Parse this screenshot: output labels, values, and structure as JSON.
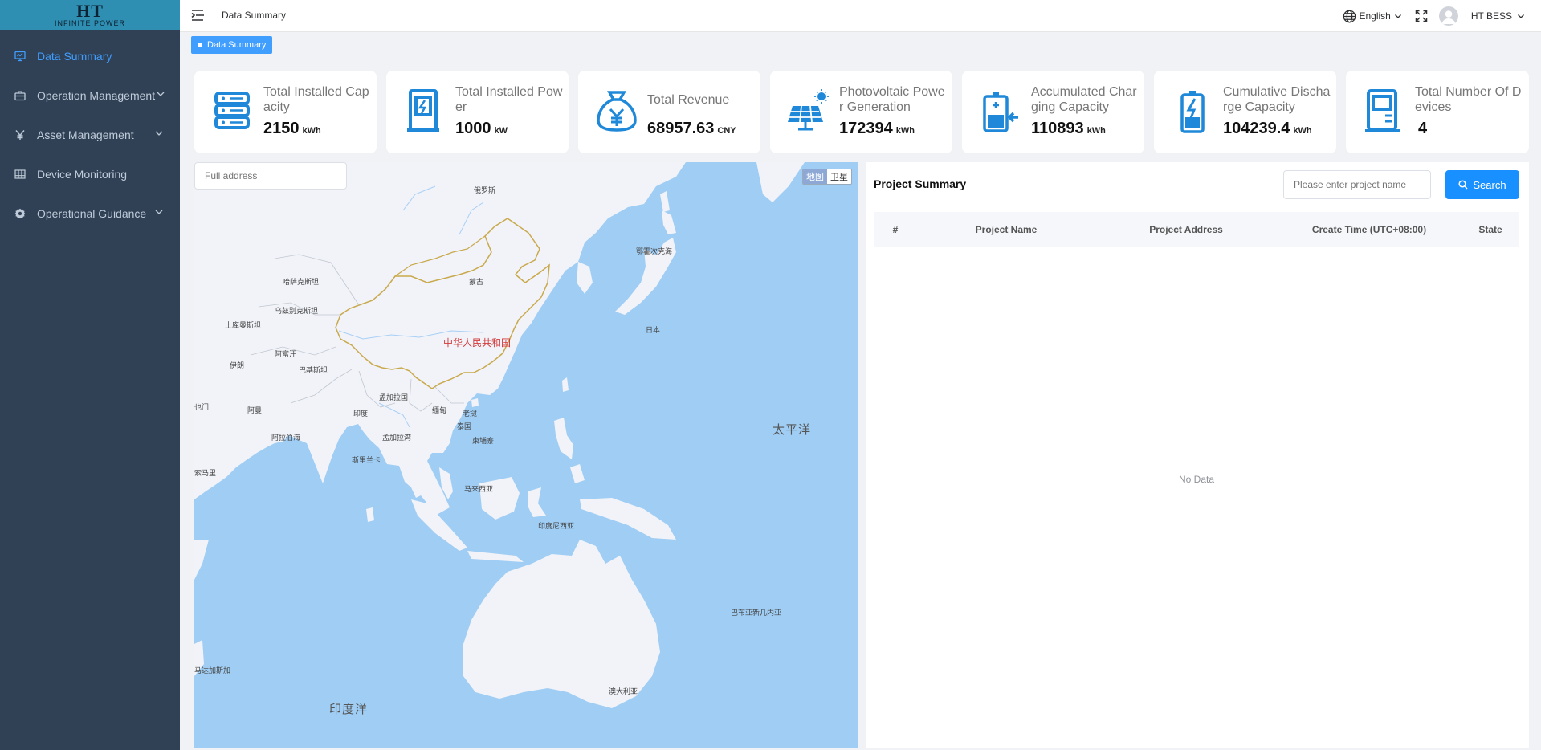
{
  "logo": {
    "mark": "HT",
    "sub": "INFINITE POWER"
  },
  "sidebar": {
    "items": [
      {
        "label": "Data Summary",
        "icon": "monitor-icon",
        "active": true
      },
      {
        "label": "Operation Management",
        "icon": "briefcase-icon",
        "has_children": true
      },
      {
        "label": "Asset Management",
        "icon": "yen-icon",
        "has_children": true
      },
      {
        "label": "Device Monitoring",
        "icon": "grid-icon"
      },
      {
        "label": "Operational Guidance",
        "icon": "gear-icon",
        "has_children": true
      }
    ]
  },
  "navbar": {
    "breadcrumb": "Data Summary",
    "language": "English",
    "user": "HT BESS"
  },
  "tags": {
    "active": "Data Summary"
  },
  "stats": [
    {
      "label": "Total Installed Capacity",
      "value": "2150",
      "unit": "kWh",
      "icon": "database-icon"
    },
    {
      "label": "Total Installed Power",
      "value": "1000",
      "unit": "kW",
      "icon": "charging-cabinet-icon"
    },
    {
      "label": "Total Revenue",
      "value": "68957.63",
      "unit": "CNY",
      "icon": "money-bag-icon"
    },
    {
      "label": "Photovoltaic Power Generation",
      "value": "172394",
      "unit": "kWh",
      "icon": "solar-panel-icon"
    },
    {
      "label": "Accumulated Charging Capacity",
      "value": "110893",
      "unit": "kWh",
      "icon": "battery-charge-icon"
    },
    {
      "label": "Cumulative Discharge Capacity",
      "value": "104239.4",
      "unit": "kWh",
      "icon": "battery-bolt-icon"
    },
    {
      "label": "Total Number Of Devices",
      "value": "4",
      "unit": "",
      "icon": "device-cabinet-icon"
    }
  ],
  "map": {
    "address_placeholder": "Full address",
    "type_map": "地图",
    "type_satellite": "卫星",
    "labels": {
      "russia": "俄罗斯",
      "kazakhstan": "哈萨克斯坦",
      "mongolia": "蒙古",
      "china": "中华人民共和国",
      "uzbekistan": "乌兹别克斯坦",
      "turkmenistan": "土库曼斯坦",
      "afghanistan": "阿富汗",
      "iran": "伊朗",
      "pakistan": "巴基斯坦",
      "oman": "阿曼",
      "india": "印度",
      "bangladesh": "孟加拉国",
      "myanmar": "缅甸",
      "thailand": "泰国",
      "laos": "老挝",
      "cambodia": "柬埔寨",
      "sri_lanka": "斯里兰卡",
      "malaysia": "马来西亚",
      "indonesia": "印度尼西亚",
      "png": "巴布亚新几内亚",
      "australia": "澳大利亚",
      "japan": "日本",
      "sea_okhotsk": "鄂霍次克海",
      "arabian_sea": "阿拉伯海",
      "bay_bengal": "孟加拉湾",
      "pacific": "太平洋",
      "indian_ocean": "印度洋",
      "somalia": "索马里",
      "madagascar": "马达加斯加",
      "yemen": "也门"
    }
  },
  "project": {
    "title": "Project Summary",
    "search_placeholder": "Please enter project name",
    "search_button": "Search",
    "columns": [
      "#",
      "Project Name",
      "Project Address",
      "Create Time (UTC+08:00)",
      "State"
    ],
    "rows": [],
    "empty_text": "No Data"
  },
  "colors": {
    "sidebar_bg": "#304156",
    "logo_bg": "#2f8fb2",
    "accent": "#409eff",
    "button": "#1890ff",
    "icon_blue": "#1f88d9"
  }
}
